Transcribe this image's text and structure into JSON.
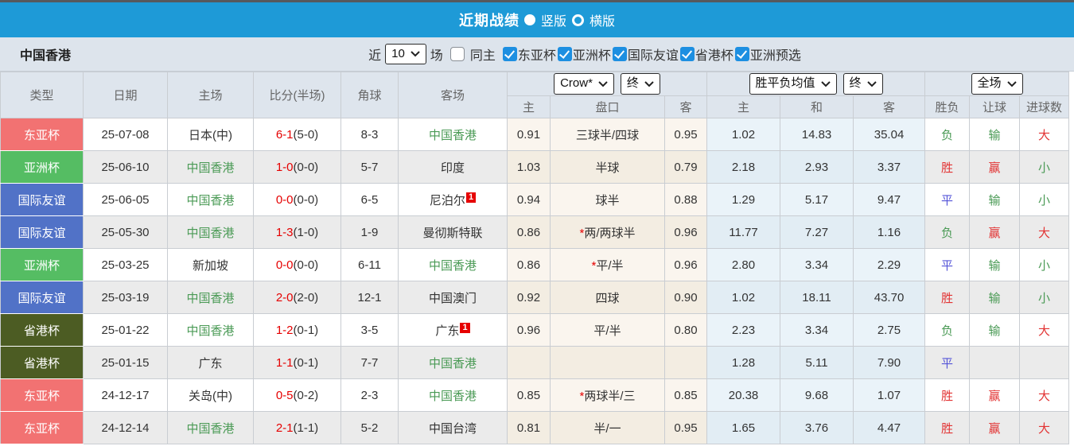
{
  "colors": {
    "accent_blue": "#1e9ad7",
    "checkbox_blue": "#1d8fe1",
    "red": "#e23333",
    "green": "#4a9a55",
    "blue": "#5454d8",
    "score_red": "#e50000",
    "team_green": "#4a9a55",
    "type_east_asia": "#f27272",
    "type_asia_cup": "#55bd63",
    "type_friendly": "#5172c7",
    "type_shenggang": "#4c5c23"
  },
  "titlebar": {
    "title": "近期战绩",
    "vertical_label": "竖版",
    "horizontal_label": "横版"
  },
  "filterbar": {
    "team": "中国香港",
    "near_label": "近",
    "match_count": "10",
    "games_label": "场",
    "same_home_label": "同主",
    "competitions": [
      "东亚杯",
      "亚洲杯",
      "国际友谊",
      "省港杯",
      "亚洲预选"
    ]
  },
  "table": {
    "selects": {
      "bookmaker": "Crow*",
      "bookmaker_stage": "终",
      "odds_avg": "胜平负均值",
      "odds_stage": "终",
      "scope": "全场"
    },
    "columns": {
      "type": "类型",
      "date": "日期",
      "home": "主场",
      "score": "比分(半场)",
      "corners": "角球",
      "away": "客场",
      "sub_home": "主",
      "sub_handicap": "盘口",
      "sub_away": "客",
      "sub_win": "主",
      "sub_draw": "和",
      "sub_lose": "客",
      "sub_wdl": "胜负",
      "sub_rq": "让球",
      "sub_goals": "进球数"
    }
  },
  "rows": [
    {
      "type": "东亚杯",
      "type_color": "type_east_asia",
      "date": "25-07-08",
      "home": "日本(中)",
      "home_is_team": false,
      "score": "6-1",
      "half": "(5-0)",
      "corners": "8-3",
      "away": "中国香港",
      "away_is_team": true,
      "away_badge": "",
      "odds_home": "0.91",
      "handicap_star": false,
      "handicap": "三球半/四球",
      "odds_away": "0.95",
      "avg_win": "1.02",
      "avg_draw": "14.83",
      "avg_lose": "35.04",
      "result_wdl": "负",
      "result_wdl_color": "green",
      "result_rq": "输",
      "result_rq_color": "green",
      "result_goals": "大",
      "result_goals_color": "red"
    },
    {
      "type": "亚洲杯",
      "type_color": "type_asia_cup",
      "date": "25-06-10",
      "home": "中国香港",
      "home_is_team": true,
      "score": "1-0",
      "half": "(0-0)",
      "corners": "5-7",
      "away": "印度",
      "away_is_team": false,
      "away_badge": "",
      "odds_home": "1.03",
      "handicap_star": false,
      "handicap": "半球",
      "odds_away": "0.79",
      "avg_win": "2.18",
      "avg_draw": "2.93",
      "avg_lose": "3.37",
      "result_wdl": "胜",
      "result_wdl_color": "red",
      "result_rq": "赢",
      "result_rq_color": "red",
      "result_goals": "小",
      "result_goals_color": "green"
    },
    {
      "type": "国际友谊",
      "type_color": "type_friendly",
      "date": "25-06-05",
      "home": "中国香港",
      "home_is_team": true,
      "score": "0-0",
      "half": "(0-0)",
      "corners": "6-5",
      "away": "尼泊尔",
      "away_is_team": false,
      "away_badge": "1",
      "odds_home": "0.94",
      "handicap_star": false,
      "handicap": "球半",
      "odds_away": "0.88",
      "avg_win": "1.29",
      "avg_draw": "5.17",
      "avg_lose": "9.47",
      "result_wdl": "平",
      "result_wdl_color": "blue",
      "result_rq": "输",
      "result_rq_color": "green",
      "result_goals": "小",
      "result_goals_color": "green"
    },
    {
      "type": "国际友谊",
      "type_color": "type_friendly",
      "date": "25-05-30",
      "home": "中国香港",
      "home_is_team": true,
      "score": "1-3",
      "half": "(1-0)",
      "corners": "1-9",
      "away": "曼彻斯特联",
      "away_is_team": false,
      "away_badge": "",
      "odds_home": "0.86",
      "handicap_star": true,
      "handicap": "两/两球半",
      "odds_away": "0.96",
      "avg_win": "11.77",
      "avg_draw": "7.27",
      "avg_lose": "1.16",
      "result_wdl": "负",
      "result_wdl_color": "green",
      "result_rq": "赢",
      "result_rq_color": "red",
      "result_goals": "大",
      "result_goals_color": "red"
    },
    {
      "type": "亚洲杯",
      "type_color": "type_asia_cup",
      "date": "25-03-25",
      "home": "新加坡",
      "home_is_team": false,
      "score": "0-0",
      "half": "(0-0)",
      "corners": "6-11",
      "away": "中国香港",
      "away_is_team": true,
      "away_badge": "",
      "odds_home": "0.86",
      "handicap_star": true,
      "handicap": "平/半",
      "odds_away": "0.96",
      "avg_win": "2.80",
      "avg_draw": "3.34",
      "avg_lose": "2.29",
      "result_wdl": "平",
      "result_wdl_color": "blue",
      "result_rq": "输",
      "result_rq_color": "green",
      "result_goals": "小",
      "result_goals_color": "green"
    },
    {
      "type": "国际友谊",
      "type_color": "type_friendly",
      "date": "25-03-19",
      "home": "中国香港",
      "home_is_team": true,
      "score": "2-0",
      "half": "(2-0)",
      "corners": "12-1",
      "away": "中国澳门",
      "away_is_team": false,
      "away_badge": "",
      "odds_home": "0.92",
      "handicap_star": false,
      "handicap": "四球",
      "odds_away": "0.90",
      "avg_win": "1.02",
      "avg_draw": "18.11",
      "avg_lose": "43.70",
      "result_wdl": "胜",
      "result_wdl_color": "red",
      "result_rq": "输",
      "result_rq_color": "green",
      "result_goals": "小",
      "result_goals_color": "green"
    },
    {
      "type": "省港杯",
      "type_color": "type_shenggang",
      "date": "25-01-22",
      "home": "中国香港",
      "home_is_team": true,
      "score": "1-2",
      "half": "(0-1)",
      "corners": "3-5",
      "away": "广东",
      "away_is_team": false,
      "away_badge": "1",
      "odds_home": "0.96",
      "handicap_star": false,
      "handicap": "平/半",
      "odds_away": "0.80",
      "avg_win": "2.23",
      "avg_draw": "3.34",
      "avg_lose": "2.75",
      "result_wdl": "负",
      "result_wdl_color": "green",
      "result_rq": "输",
      "result_rq_color": "green",
      "result_goals": "大",
      "result_goals_color": "red"
    },
    {
      "type": "省港杯",
      "type_color": "type_shenggang",
      "date": "25-01-15",
      "home": "广东",
      "home_is_team": false,
      "score": "1-1",
      "half": "(0-1)",
      "corners": "7-7",
      "away": "中国香港",
      "away_is_team": true,
      "away_badge": "",
      "odds_home": "",
      "handicap_star": false,
      "handicap": "",
      "odds_away": "",
      "avg_win": "1.28",
      "avg_draw": "5.11",
      "avg_lose": "7.90",
      "result_wdl": "平",
      "result_wdl_color": "blue",
      "result_rq": "",
      "result_rq_color": "green",
      "result_goals": "",
      "result_goals_color": "green"
    },
    {
      "type": "东亚杯",
      "type_color": "type_east_asia",
      "date": "24-12-17",
      "home": "关岛(中)",
      "home_is_team": false,
      "score": "0-5",
      "half": "(0-2)",
      "corners": "2-3",
      "away": "中国香港",
      "away_is_team": true,
      "away_badge": "",
      "odds_home": "0.85",
      "handicap_star": true,
      "handicap": "两球半/三",
      "odds_away": "0.85",
      "avg_win": "20.38",
      "avg_draw": "9.68",
      "avg_lose": "1.07",
      "result_wdl": "胜",
      "result_wdl_color": "red",
      "result_rq": "赢",
      "result_rq_color": "red",
      "result_goals": "大",
      "result_goals_color": "red"
    },
    {
      "type": "东亚杯",
      "type_color": "type_east_asia",
      "date": "24-12-14",
      "home": "中国香港",
      "home_is_team": true,
      "score": "2-1",
      "half": "(1-1)",
      "corners": "5-2",
      "away": "中国台湾",
      "away_is_team": false,
      "away_badge": "",
      "odds_home": "0.81",
      "handicap_star": false,
      "handicap": "半/一",
      "odds_away": "0.95",
      "avg_win": "1.65",
      "avg_draw": "3.76",
      "avg_lose": "4.47",
      "result_wdl": "胜",
      "result_wdl_color": "red",
      "result_rq": "赢",
      "result_rq_color": "red",
      "result_goals": "大",
      "result_goals_color": "red"
    }
  ]
}
